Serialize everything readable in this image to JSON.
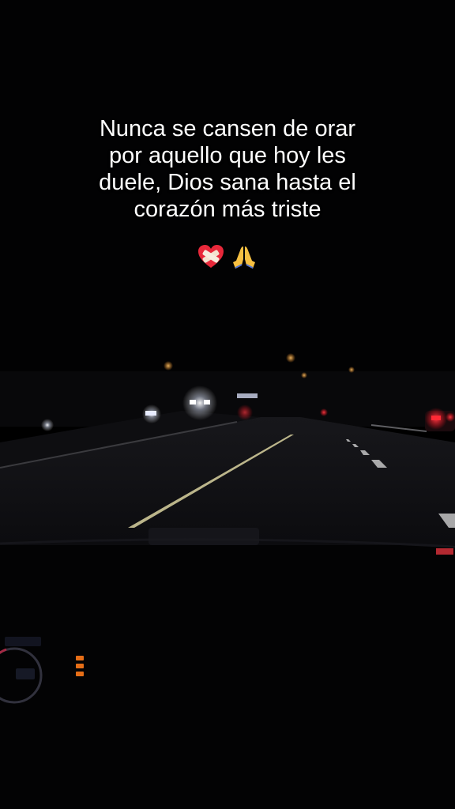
{
  "caption": {
    "lines": [
      "Nunca se cansen de orar",
      "por aquello que hoy les",
      "duele, Dios sana hasta el",
      "corazón más triste"
    ],
    "emojis": [
      "mending-heart-icon",
      "praying-hands-icon"
    ]
  },
  "scene": {
    "description_colors": {
      "sky": "#020203",
      "road": "#0c0c0f",
      "lane_line": "#d9d2a0",
      "tail_light": "#ff2a35",
      "dash_orange": "#ff7a1a"
    }
  }
}
